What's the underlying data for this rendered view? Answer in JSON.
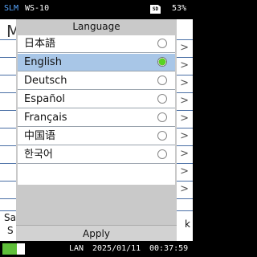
{
  "status_bar": {
    "mode": "SLM",
    "model": "WS-10",
    "sd_label": "SD",
    "battery": "53%"
  },
  "background": {
    "title_initial": "M",
    "left_text_1": "Sa",
    "left_text_2": "S",
    "right_text": "k",
    "chevron": ">"
  },
  "dialog": {
    "title": "Language",
    "apply_label": "Apply",
    "languages": [
      {
        "label": "日本語",
        "selected": false
      },
      {
        "label": "English",
        "selected": true
      },
      {
        "label": "Deutsch",
        "selected": false
      },
      {
        "label": "Español",
        "selected": false
      },
      {
        "label": "Français",
        "selected": false
      },
      {
        "label": "中国语",
        "selected": false
      },
      {
        "label": "한국어",
        "selected": false
      }
    ]
  },
  "bottom_bar": {
    "network": "LAN",
    "date": "2025/01/11",
    "time": "00:37:59"
  },
  "colors": {
    "selected_row": "#a8c6e7",
    "radio_on": "#59d321",
    "mode_text": "#58a6ff"
  }
}
